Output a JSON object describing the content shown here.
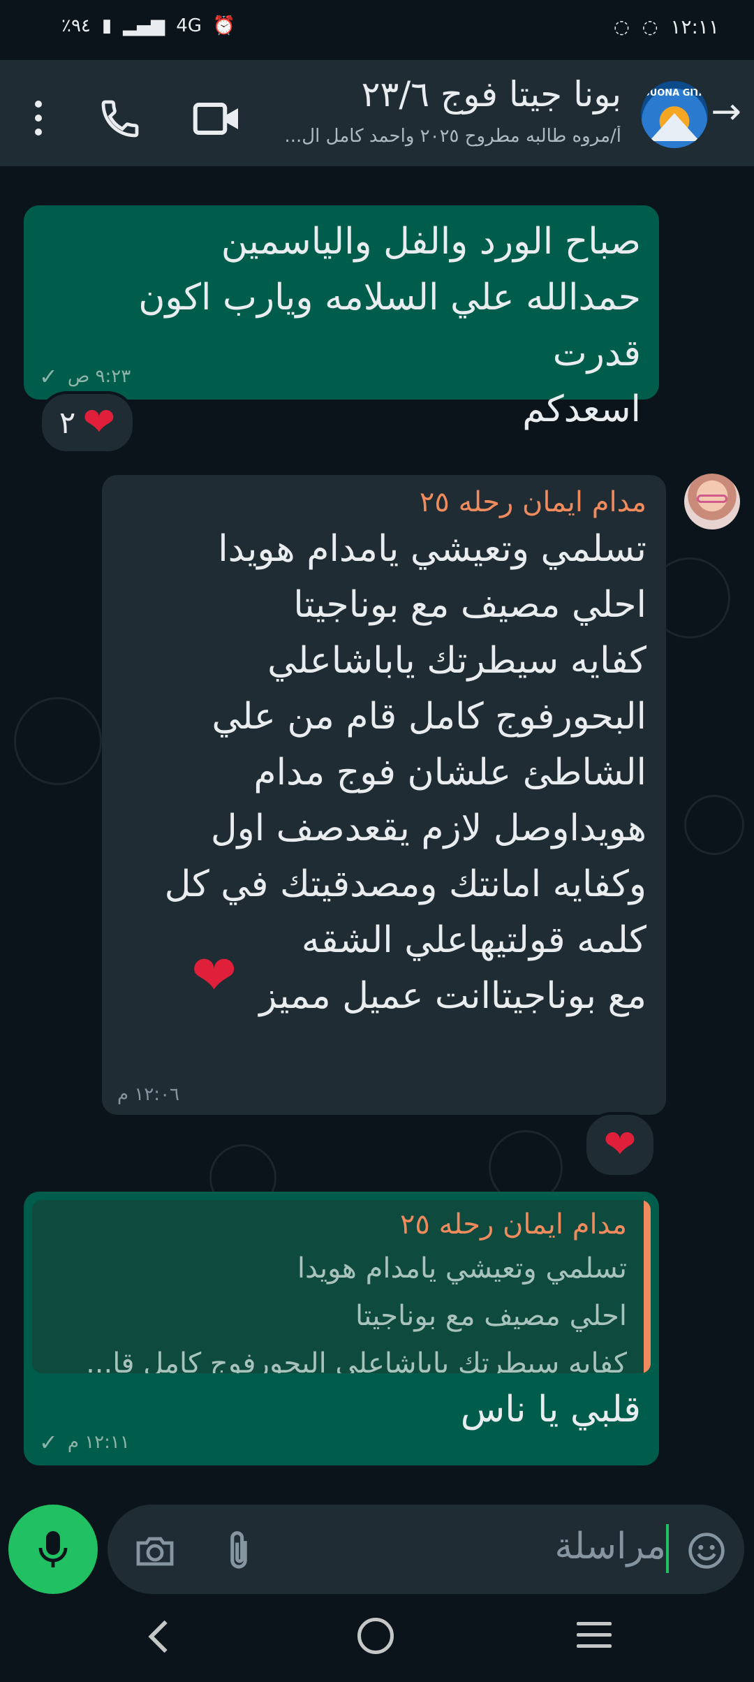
{
  "status_bar": {
    "battery": "٪٩٤",
    "network": "4G",
    "time": "١٢:١١"
  },
  "header": {
    "title": "بونا جيتا فوج ٢٣/٦",
    "subtitle": "أ/مروه طالبه مطروح ٢٠٢٥ واحمد كامل ال...",
    "avatar_text": "BUONA GITA"
  },
  "messages": {
    "m1": {
      "text": "صباح الورد والفل والياسمين\nحمدالله علي السلامه  ويارب اكون قدرت\nاسعدكم",
      "time": "٩:٢٣ ص",
      "reaction_count": "٢"
    },
    "m2": {
      "sender": "مدام ايمان رحله ٢٥",
      "text": "تسلمي وتعيشي يامدام هويدا\nاحلي مصيف مع بوناجيتا\nكفايه سيطرتك ياباشاعلي\nالبحورفوج كامل قام من علي\nالشاطئ علشان فوج مدام\nهويداوصل لازم يقعدصف اول\nوكفايه امانتك ومصدقيتك في كل\nكلمه قولتيهاعلي الشقه\nمع بوناجيتاانت عميل مميز",
      "time": "١٢:٠٦ م"
    },
    "m3": {
      "quote_sender": "مدام ايمان رحله ٢٥",
      "quote_text": "تسلمي وتعيشي يامدام هويدا\nاحلي مصيف مع بوناجيتا\nكفايه سيطرتك ياباشاعلي البحورفوج كامل قا...",
      "text": "قلبي يا ناس",
      "time": "١٢:١١ م"
    }
  },
  "input": {
    "placeholder": "مراسلة"
  },
  "colors": {
    "background": "#0b141a",
    "outgoing_bubble": "#005c4b",
    "incoming_bubble": "#1f2c34",
    "accent_green": "#21c063",
    "sender_name": "#f08b5e"
  }
}
